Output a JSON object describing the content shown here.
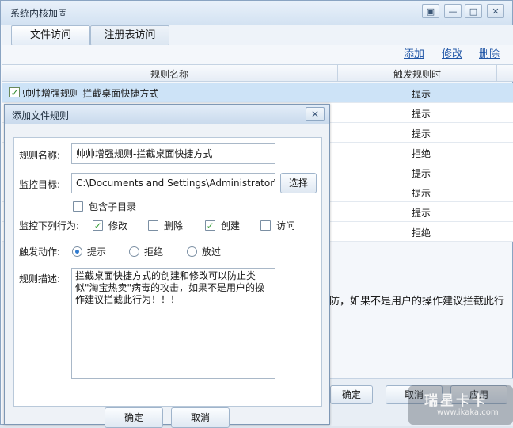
{
  "window": {
    "title": "系统内核加固",
    "controls": {
      "menu": "▣",
      "minimize": "—",
      "maximize": "□",
      "close": "✕"
    }
  },
  "tabs": [
    {
      "label": "文件访问",
      "active": true
    },
    {
      "label": "注册表访问",
      "active": false
    }
  ],
  "actions": {
    "add": "添加",
    "edit": "修改",
    "delete": "删除"
  },
  "table": {
    "headers": {
      "name": "规则名称",
      "trigger": "触发规则时"
    },
    "rows": [
      {
        "name": "帅帅增强规则-拦截桌面快捷方式",
        "trigger": "提示",
        "checked": true,
        "selected": true
      },
      {
        "name": "",
        "trigger": "提示"
      },
      {
        "name": "",
        "trigger": "提示"
      },
      {
        "name": "",
        "trigger": "拒绝"
      },
      {
        "name": "",
        "trigger": "提示"
      },
      {
        "name": "",
        "trigger": "提示"
      },
      {
        "name": "",
        "trigger": "提示"
      },
      {
        "name": "",
        "trigger": "拒绝"
      }
    ],
    "description_partial": "防，如果不是用户的操作建议拦截此行"
  },
  "outer_buttons": {
    "ok": "确定",
    "cancel": "取消",
    "apply": "应用"
  },
  "watermark": {
    "brand": "瑞星卡卡",
    "url": "www.ikaka.com"
  },
  "dialog": {
    "title": "添加文件规则",
    "close_glyph": "✕",
    "rule_name_label": "规则名称:",
    "rule_name_value": "帅帅增强规则-拦截桌面快捷方式",
    "target_label": "监控目标:",
    "target_value": "C:\\Documents and Settings\\Administrator\\桌面\\*.lr",
    "browse_button": "选择",
    "include_subdirs_label": "包含子目录",
    "include_subdirs_checked": false,
    "monitor_label": "监控下列行为:",
    "behaviors": [
      {
        "label": "修改",
        "checked": true
      },
      {
        "label": "删除",
        "checked": false
      },
      {
        "label": "创建",
        "checked": true
      },
      {
        "label": "访问",
        "checked": false
      }
    ],
    "action_label": "触发动作:",
    "actions": [
      {
        "label": "提示",
        "selected": true
      },
      {
        "label": "拒绝",
        "selected": false
      },
      {
        "label": "放过",
        "selected": false
      }
    ],
    "desc_label": "规则描述:",
    "desc_value": "拦截桌面快捷方式的创建和修改可以防止类似\"淘宝热卖\"病毒的攻击，如果不是用户的操作建议拦截此行为！！！",
    "ok_button": "确定",
    "cancel_button": "取消"
  }
}
